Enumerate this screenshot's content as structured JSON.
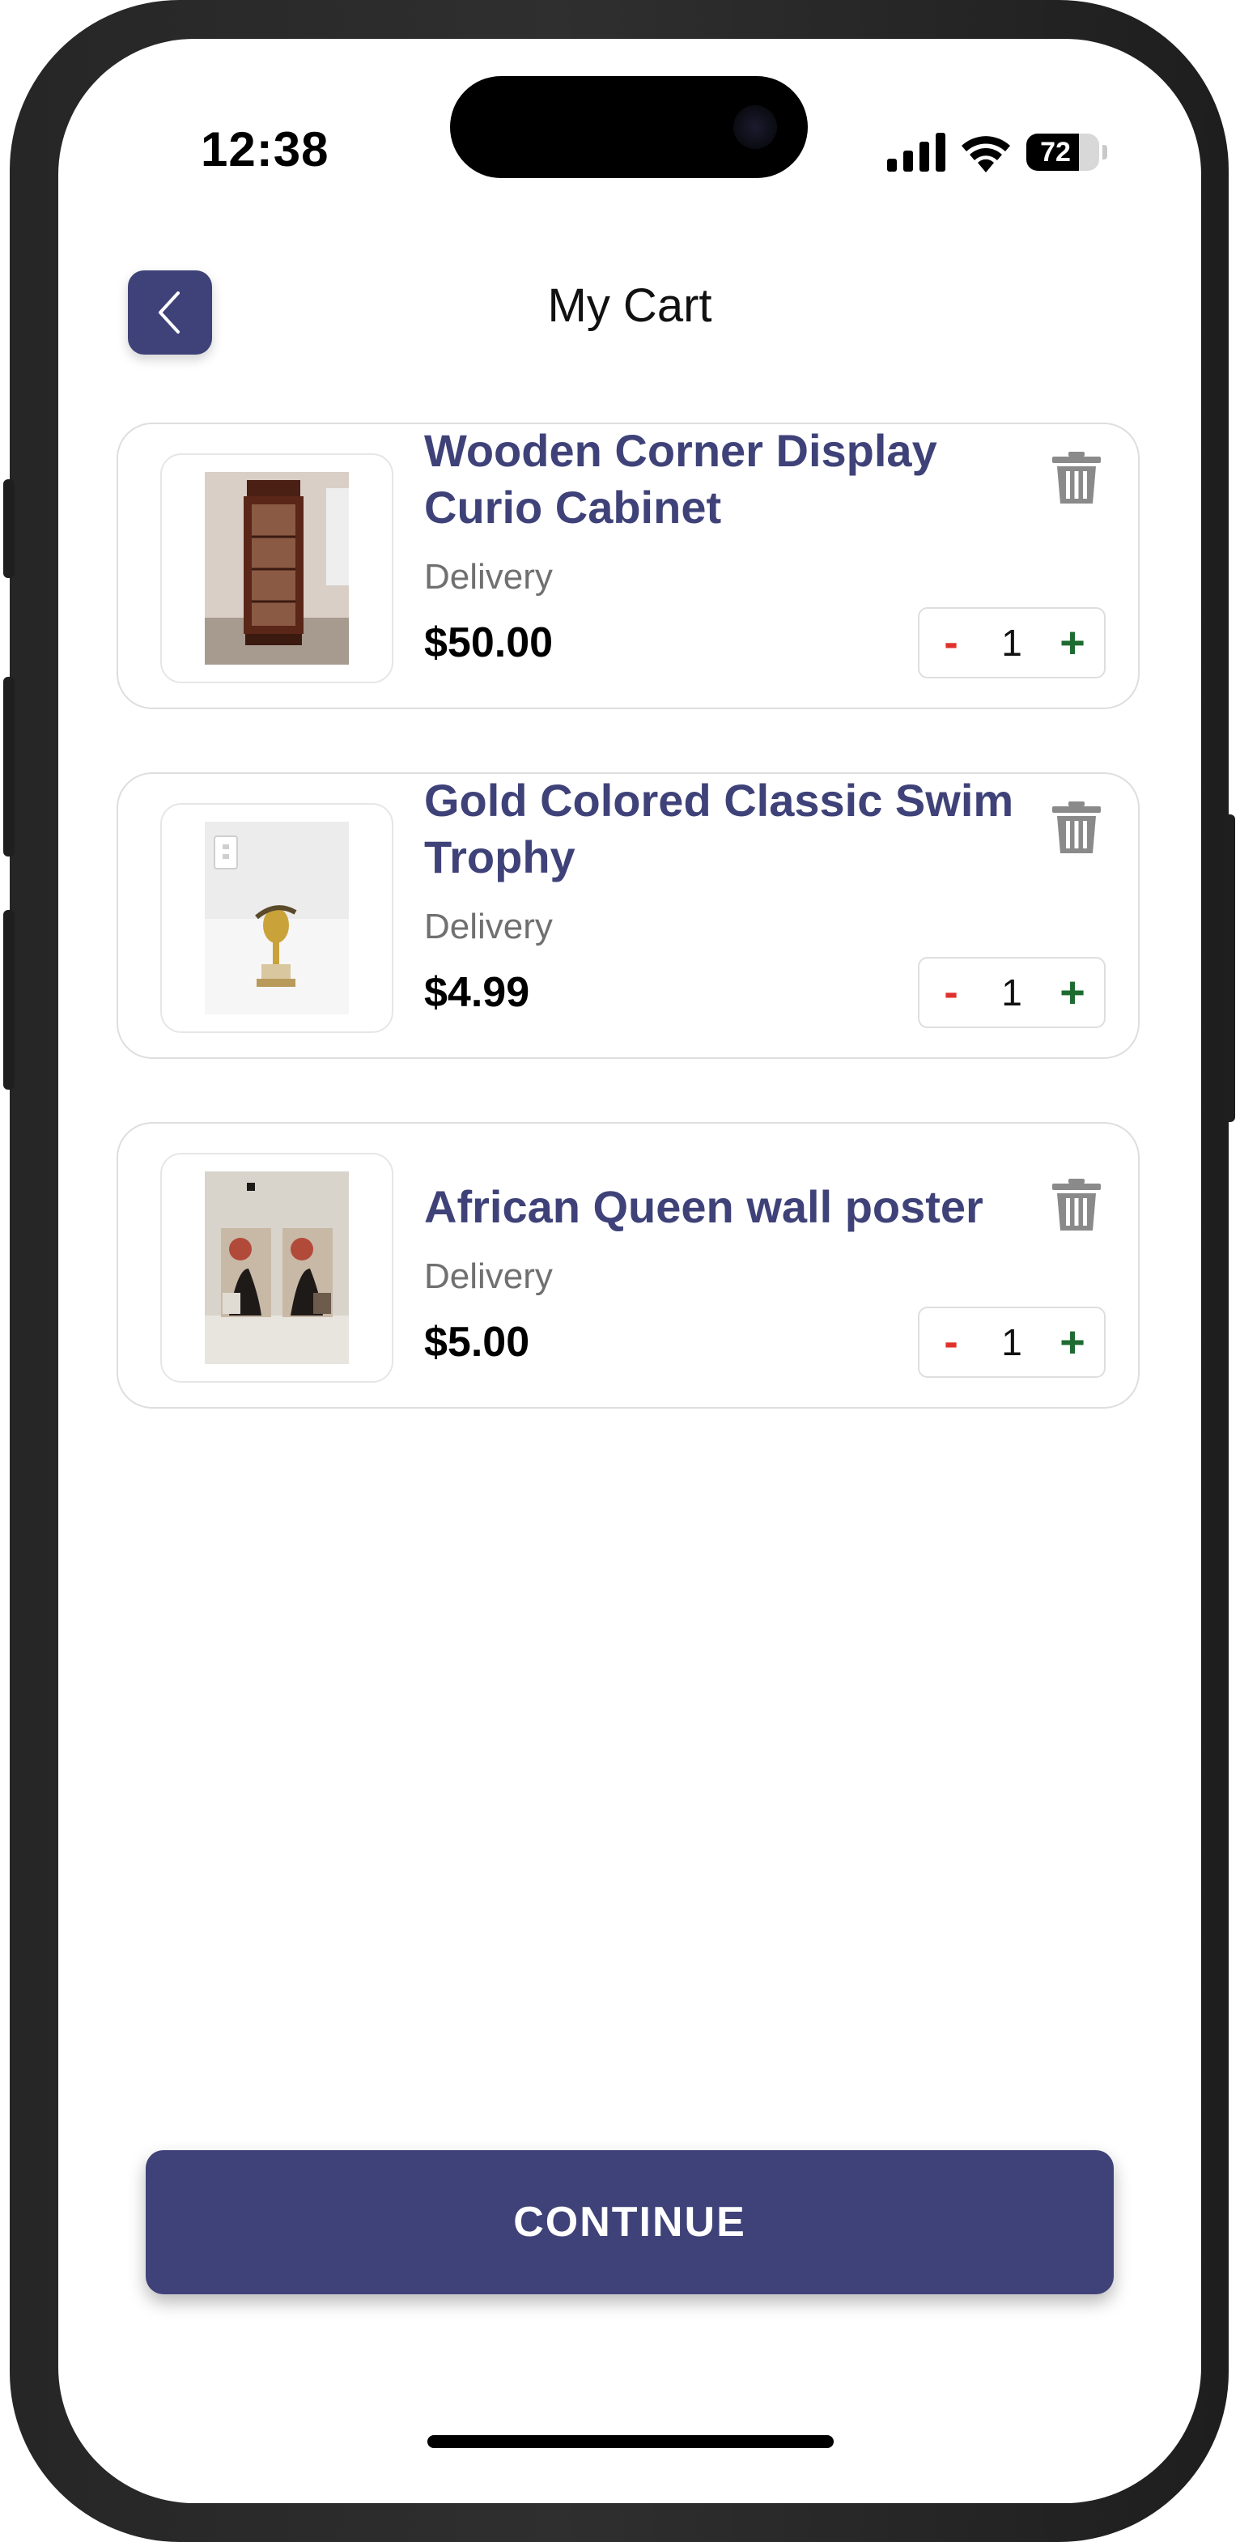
{
  "status_bar": {
    "time": "12:38",
    "battery_level": "72",
    "battery_fraction": 0.72,
    "icons": [
      "cellular-signal-icon",
      "wifi-icon",
      "battery-icon"
    ]
  },
  "header": {
    "title": "My Cart",
    "back_icon": "chevron-left-icon"
  },
  "cart_items": [
    {
      "title": "Wooden Corner Display Curio Cabinet",
      "subtitle": "Delivery",
      "price": "$50.00",
      "quantity": "1",
      "minus_label": "-",
      "plus_label": "+"
    },
    {
      "title": "Gold Colored Classic Swim Trophy",
      "subtitle": "Delivery",
      "price": "$4.99",
      "quantity": "1",
      "minus_label": "-",
      "plus_label": "+"
    },
    {
      "title": "African Queen wall poster",
      "subtitle": "Delivery",
      "price": "$5.00",
      "quantity": "1",
      "minus_label": "-",
      "plus_label": "+"
    }
  ],
  "footer": {
    "continue_label": "CONTINUE"
  },
  "colors": {
    "accent": "#3f4278",
    "minus": "#e0312c",
    "plus": "#1e6b32",
    "muted_text": "#707070",
    "icon_gray": "#8a8a8a"
  }
}
